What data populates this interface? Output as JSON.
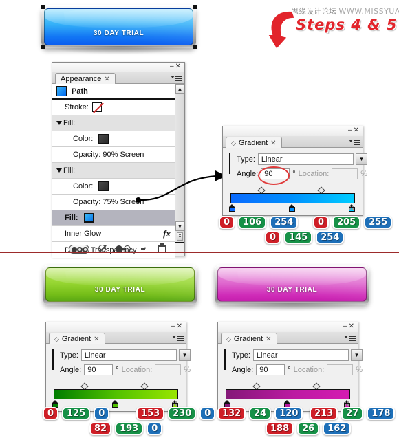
{
  "page": {
    "background": "#ffffff",
    "divider_color": "#9c2b2b"
  },
  "annotation": {
    "steps_label": "Steps 4 & 5",
    "steps_color": "#e2242b",
    "watermark_cn": "思缘设计论坛",
    "watermark_url": "WWW.MISSYUAN.COM",
    "arrow_icon": "curved-down-arrow-icon"
  },
  "buttons": [
    {
      "id": "blue",
      "label": "30 DAY TRIAL",
      "gradient_top": "#6fd2fb",
      "gradient_mid": "#2aa8f7",
      "gradient_bottom": "#0b5ef0",
      "selected": true
    },
    {
      "id": "green",
      "label": "30 DAY TRIAL",
      "gradient_top": "#a9e04a",
      "gradient_mid": "#85cc2b",
      "gradient_bottom": "#5aa914",
      "selected": false
    },
    {
      "id": "magenta",
      "label": "30 DAY TRIAL",
      "gradient_top": "#e683d8",
      "gradient_mid": "#da4fc4",
      "gradient_bottom": "#c61fae",
      "selected": false
    }
  ],
  "appearance_panel": {
    "tab_label": "Appearance",
    "tab_close_icon": "close-icon",
    "menu_icon": "panel-menu-icon",
    "minimize_icon": "minimize-icon",
    "close_icon": "close-icon",
    "scroll_up_icon": "chevron-up-icon",
    "scroll_down_icon": "chevron-down-icon",
    "rows": [
      {
        "label": "Path",
        "type": "header",
        "swatch": "gradient-blue-swatch"
      },
      {
        "label": "Stroke:",
        "type": "stroke",
        "swatch": "none-swatch"
      },
      {
        "label": "Fill:",
        "type": "group",
        "disclosure": "triangle-down-icon"
      },
      {
        "label": "Color:",
        "type": "color",
        "swatch": "dark-swatch"
      },
      {
        "label": "Opacity: 90% Screen",
        "type": "opacity"
      },
      {
        "label": "Fill:",
        "type": "group",
        "disclosure": "triangle-down-icon"
      },
      {
        "label": "Color:",
        "type": "color",
        "swatch": "dark-swatch"
      },
      {
        "label": "Opacity: 75% Screen",
        "type": "opacity"
      },
      {
        "label": "Fill:",
        "type": "selected",
        "swatch": "gradient-blue-swatch"
      },
      {
        "label": "Inner Glow",
        "type": "effect",
        "badge": "fx"
      },
      {
        "label": "Default Transparency",
        "type": "plain"
      }
    ],
    "footer_icons": [
      "toggle-visibility-icon",
      "clear-appearance-icon",
      "reduce-to-basic-icon",
      "duplicate-item-icon",
      "delete-item-icon"
    ]
  },
  "gradient_panels": [
    {
      "id": "blue-gradient",
      "tab_label": "Gradient",
      "tab_diamond_icon": "gradient-diamond-icon",
      "tab_close_icon": "close-icon",
      "type_label": "Type:",
      "type_value": "Linear",
      "type_dropdown_icon": "chevron-down-icon",
      "angle_label": "Angle:",
      "angle_value": "90",
      "angle_unit": "°",
      "angle_highlighted": true,
      "location_label": "Location:",
      "location_value": "",
      "location_unit": "%",
      "preview_from": "#0b5ef0",
      "preview_to": "#23c8ff",
      "stops": [
        {
          "position": 0,
          "color": "#0a6afe"
        },
        {
          "position": 50,
          "color": "#0091fe"
        },
        {
          "position": 100,
          "color": "#00cdff"
        }
      ],
      "midpoints": [
        25,
        75
      ],
      "rgb_readouts": [
        {
          "which": "left-stop",
          "r": "0",
          "g": "106",
          "b": "254"
        },
        {
          "which": "right-stop",
          "r": "0",
          "g": "205",
          "b": "255"
        },
        {
          "which": "middle-stop",
          "r": "0",
          "g": "145",
          "b": "254"
        }
      ]
    },
    {
      "id": "green-gradient",
      "tab_label": "Gradient",
      "tab_diamond_icon": "gradient-diamond-icon",
      "tab_close_icon": "close-icon",
      "type_label": "Type:",
      "type_value": "Linear",
      "type_dropdown_icon": "chevron-down-icon",
      "angle_label": "Angle:",
      "angle_value": "90",
      "angle_unit": "°",
      "angle_highlighted": false,
      "location_label": "Location:",
      "location_value": "",
      "location_unit": "%",
      "preview_from": "#1a7d00",
      "preview_to": "#7ec600",
      "stops": [
        {
          "position": 0,
          "color": "#007d00"
        },
        {
          "position": 50,
          "color": "#52c100"
        },
        {
          "position": 100,
          "color": "#99e600"
        }
      ],
      "midpoints": [
        25,
        75
      ],
      "rgb_readouts": [
        {
          "which": "left-stop",
          "r": "0",
          "g": "125",
          "b": "0"
        },
        {
          "which": "right-stop",
          "r": "153",
          "g": "230",
          "b": "0"
        },
        {
          "which": "middle-stop",
          "r": "82",
          "g": "193",
          "b": "0"
        }
      ]
    },
    {
      "id": "magenta-gradient",
      "tab_label": "Gradient",
      "tab_diamond_icon": "gradient-diamond-icon",
      "tab_close_icon": "close-icon",
      "type_label": "Type:",
      "type_value": "Linear",
      "type_dropdown_icon": "chevron-down-icon",
      "angle_label": "Angle:",
      "angle_value": "90",
      "angle_unit": "°",
      "angle_highlighted": false,
      "location_label": "Location:",
      "location_value": "",
      "location_unit": "%",
      "preview_from": "#841878",
      "preview_to": "#d51bb2",
      "stops": [
        {
          "position": 0,
          "color": "#841878"
        },
        {
          "position": 50,
          "color": "#bc1aa2"
        },
        {
          "position": 100,
          "color": "#d51bb2"
        }
      ],
      "midpoints": [
        25,
        75
      ],
      "rgb_readouts": [
        {
          "which": "left-stop",
          "r": "132",
          "g": "24",
          "b": "120"
        },
        {
          "which": "right-stop",
          "r": "213",
          "g": "27",
          "b": "178"
        },
        {
          "which": "middle-stop",
          "r": "188",
          "g": "26",
          "b": "162"
        }
      ]
    }
  ]
}
